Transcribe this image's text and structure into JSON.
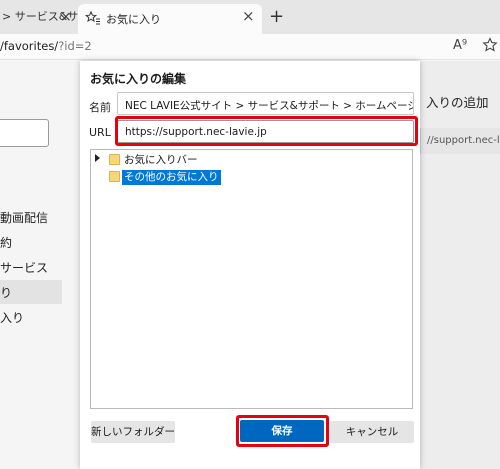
{
  "browser": {
    "tabs": [
      {
        "label": "> サービス&サ",
        "active": false
      },
      {
        "label": "お気に入り",
        "active": true
      }
    ],
    "new_tab_label": "+",
    "close_glyph": "×",
    "address": {
      "prefix": "/favorites/",
      "suffix": "?id=2"
    },
    "read_aloud_label": "A⁹"
  },
  "background_page": {
    "nav_items": [
      "動画配信",
      "約",
      "サービス",
      "り",
      "入り"
    ],
    "right_panel_title": "入りの追加",
    "right_panel_url": "//support.nec-lavie"
  },
  "dialog": {
    "title": "お気に入りの編集",
    "name_label": "名前",
    "name_value": "NEC LAVIE公式サイト > サービス&サポート > ホームページ",
    "url_label": "URL",
    "url_value": "https://support.nec-lavie.jp",
    "folders": [
      {
        "label": "お気に入りバー",
        "expandable": true,
        "selected": false
      },
      {
        "label": "その他のお気に入り",
        "expandable": false,
        "selected": true
      }
    ],
    "new_folder_label": "新しいフォルダー",
    "save_label": "保存",
    "cancel_label": "キャンセル"
  },
  "colors": {
    "highlight": "#e60012",
    "primary_button": "#0067c0",
    "selection": "#0078d7"
  }
}
